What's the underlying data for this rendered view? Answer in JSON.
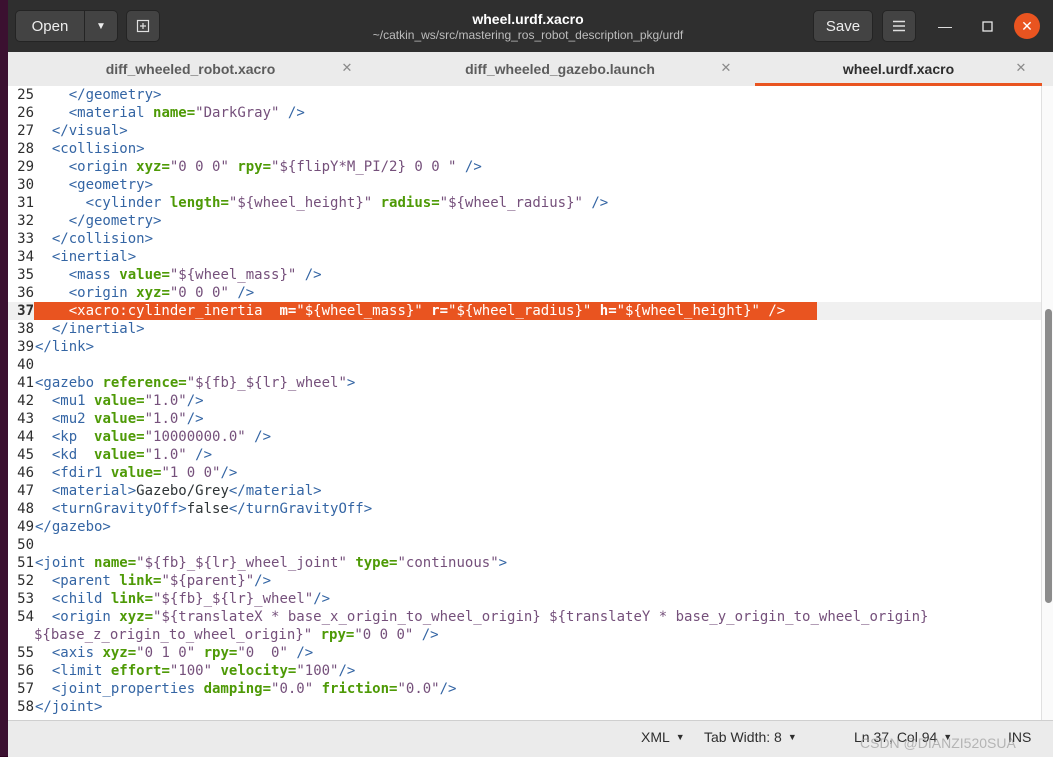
{
  "header": {
    "open_label": "Open",
    "title": "wheel.urdf.xacro",
    "path": "~/catkin_ws/src/mastering_ros_robot_description_pkg/urdf",
    "save_label": "Save"
  },
  "tabs": [
    {
      "label": "diff_wheeled_robot.xacro"
    },
    {
      "label": "diff_wheeled_gazebo.launch"
    },
    {
      "label": "wheel.urdf.xacro",
      "active": true
    }
  ],
  "colors": {
    "accent": "#e95420",
    "tag": "#3465a4",
    "attribute": "#4e9a06",
    "string": "#75507b"
  },
  "editor": {
    "lines": [
      {
        "n": "25",
        "tokens": [
          [
            "tx",
            "    "
          ],
          [
            "t",
            "</geometry>"
          ]
        ]
      },
      {
        "n": "26",
        "tokens": [
          [
            "tx",
            "    "
          ],
          [
            "t",
            "<material "
          ],
          [
            "a",
            "name="
          ],
          [
            "v",
            "\"DarkGray\""
          ],
          [
            "t",
            " />"
          ]
        ]
      },
      {
        "n": "27",
        "tokens": [
          [
            "tx",
            "  "
          ],
          [
            "t",
            "</visual>"
          ]
        ]
      },
      {
        "n": "28",
        "tokens": [
          [
            "tx",
            "  "
          ],
          [
            "t",
            "<collision>"
          ]
        ]
      },
      {
        "n": "29",
        "tokens": [
          [
            "tx",
            "    "
          ],
          [
            "t",
            "<origin "
          ],
          [
            "a",
            "xyz="
          ],
          [
            "v",
            "\"0 0 0\""
          ],
          [
            "tx",
            " "
          ],
          [
            "a",
            "rpy="
          ],
          [
            "v",
            "\"${flipY*M_PI/2} 0 0 \""
          ],
          [
            "t",
            " />"
          ]
        ]
      },
      {
        "n": "30",
        "tokens": [
          [
            "tx",
            "    "
          ],
          [
            "t",
            "<geometry>"
          ]
        ]
      },
      {
        "n": "31",
        "tokens": [
          [
            "tx",
            "      "
          ],
          [
            "t",
            "<cylinder "
          ],
          [
            "a",
            "length="
          ],
          [
            "v",
            "\"${wheel_height}\""
          ],
          [
            "tx",
            " "
          ],
          [
            "a",
            "radius="
          ],
          [
            "v",
            "\"${wheel_radius}\""
          ],
          [
            "t",
            " />"
          ]
        ]
      },
      {
        "n": "32",
        "tokens": [
          [
            "tx",
            "    "
          ],
          [
            "t",
            "</geometry>"
          ]
        ]
      },
      {
        "n": "33",
        "tokens": [
          [
            "tx",
            "  "
          ],
          [
            "t",
            "</collision>"
          ]
        ]
      },
      {
        "n": "34",
        "tokens": [
          [
            "tx",
            "  "
          ],
          [
            "t",
            "<inertial>"
          ]
        ]
      },
      {
        "n": "35",
        "tokens": [
          [
            "tx",
            "    "
          ],
          [
            "t",
            "<mass "
          ],
          [
            "a",
            "value="
          ],
          [
            "v",
            "\"${wheel_mass}\""
          ],
          [
            "t",
            " />"
          ]
        ]
      },
      {
        "n": "36",
        "tokens": [
          [
            "tx",
            "    "
          ],
          [
            "t",
            "<origin "
          ],
          [
            "a",
            "xyz="
          ],
          [
            "v",
            "\"0 0 0\""
          ],
          [
            "t",
            " />"
          ]
        ]
      },
      {
        "n": "37",
        "current": true,
        "tokens": [
          [
            "tx",
            "    "
          ],
          [
            "t",
            "<xacro:cylinder_inertia  "
          ],
          [
            "a",
            "m="
          ],
          [
            "v",
            "\"${wheel_mass}\""
          ],
          [
            "tx",
            " "
          ],
          [
            "a",
            "r="
          ],
          [
            "v",
            "\"${wheel_radius}\""
          ],
          [
            "tx",
            " "
          ],
          [
            "a",
            "h="
          ],
          [
            "v",
            "\"${wheel_height}\""
          ],
          [
            "t",
            " />"
          ]
        ]
      },
      {
        "n": "38",
        "tokens": [
          [
            "tx",
            "  "
          ],
          [
            "t",
            "</inertial>"
          ]
        ]
      },
      {
        "n": "39",
        "tokens": [
          [
            "t",
            "</link>"
          ]
        ]
      },
      {
        "n": "40",
        "tokens": []
      },
      {
        "n": "41",
        "tokens": [
          [
            "t",
            "<gazebo "
          ],
          [
            "a",
            "reference="
          ],
          [
            "v",
            "\"${fb}_${lr}_wheel\""
          ],
          [
            "t",
            ">"
          ]
        ]
      },
      {
        "n": "42",
        "tokens": [
          [
            "tx",
            "  "
          ],
          [
            "t",
            "<mu1 "
          ],
          [
            "a",
            "value="
          ],
          [
            "v",
            "\"1.0\""
          ],
          [
            "t",
            "/>"
          ]
        ]
      },
      {
        "n": "43",
        "tokens": [
          [
            "tx",
            "  "
          ],
          [
            "t",
            "<mu2 "
          ],
          [
            "a",
            "value="
          ],
          [
            "v",
            "\"1.0\""
          ],
          [
            "t",
            "/>"
          ]
        ]
      },
      {
        "n": "44",
        "tokens": [
          [
            "tx",
            "  "
          ],
          [
            "t",
            "<kp  "
          ],
          [
            "a",
            "value="
          ],
          [
            "v",
            "\"10000000.0\""
          ],
          [
            "t",
            " />"
          ]
        ]
      },
      {
        "n": "45",
        "tokens": [
          [
            "tx",
            "  "
          ],
          [
            "t",
            "<kd  "
          ],
          [
            "a",
            "value="
          ],
          [
            "v",
            "\"1.0\""
          ],
          [
            "t",
            " />"
          ]
        ]
      },
      {
        "n": "46",
        "tokens": [
          [
            "tx",
            "  "
          ],
          [
            "t",
            "<fdir1 "
          ],
          [
            "a",
            "value="
          ],
          [
            "v",
            "\"1 0 0\""
          ],
          [
            "t",
            "/>"
          ]
        ]
      },
      {
        "n": "47",
        "tokens": [
          [
            "tx",
            "  "
          ],
          [
            "t",
            "<material>"
          ],
          [
            "tx",
            "Gazebo/Grey"
          ],
          [
            "t",
            "</material>"
          ]
        ]
      },
      {
        "n": "48",
        "tokens": [
          [
            "tx",
            "  "
          ],
          [
            "t",
            "<turnGravityOff>"
          ],
          [
            "tx",
            "false"
          ],
          [
            "t",
            "</turnGravityOff>"
          ]
        ]
      },
      {
        "n": "49",
        "tokens": [
          [
            "t",
            "</gazebo>"
          ]
        ]
      },
      {
        "n": "50",
        "tokens": []
      },
      {
        "n": "51",
        "tokens": [
          [
            "t",
            "<joint "
          ],
          [
            "a",
            "name="
          ],
          [
            "v",
            "\"${fb}_${lr}_wheel_joint\""
          ],
          [
            "tx",
            " "
          ],
          [
            "a",
            "type="
          ],
          [
            "v",
            "\"continuous\""
          ],
          [
            "t",
            ">"
          ]
        ]
      },
      {
        "n": "52",
        "tokens": [
          [
            "tx",
            "  "
          ],
          [
            "t",
            "<parent "
          ],
          [
            "a",
            "link="
          ],
          [
            "v",
            "\"${parent}\""
          ],
          [
            "t",
            "/>"
          ]
        ]
      },
      {
        "n": "53",
        "tokens": [
          [
            "tx",
            "  "
          ],
          [
            "t",
            "<child "
          ],
          [
            "a",
            "link="
          ],
          [
            "v",
            "\"${fb}_${lr}_wheel\""
          ],
          [
            "t",
            "/>"
          ]
        ]
      },
      {
        "n": "54",
        "tokens": [
          [
            "tx",
            "  "
          ],
          [
            "t",
            "<origin "
          ],
          [
            "a",
            "xyz="
          ],
          [
            "v",
            "\"${translateX * base_x_origin_to_wheel_origin} ${translateY * base_y_origin_to_wheel_origin}"
          ]
        ]
      },
      {
        "n": "",
        "wrap": true,
        "tokens": [
          [
            "v",
            "${base_z_origin_to_wheel_origin}\""
          ],
          [
            "tx",
            " "
          ],
          [
            "a",
            "rpy="
          ],
          [
            "v",
            "\"0 0 0\""
          ],
          [
            "t",
            " />"
          ]
        ]
      },
      {
        "n": "55",
        "tokens": [
          [
            "tx",
            "  "
          ],
          [
            "t",
            "<axis "
          ],
          [
            "a",
            "xyz="
          ],
          [
            "v",
            "\"0 1 0\""
          ],
          [
            "tx",
            " "
          ],
          [
            "a",
            "rpy="
          ],
          [
            "v",
            "\"0  0\""
          ],
          [
            "t",
            " />"
          ]
        ]
      },
      {
        "n": "56",
        "tokens": [
          [
            "tx",
            "  "
          ],
          [
            "t",
            "<limit "
          ],
          [
            "a",
            "effort="
          ],
          [
            "v",
            "\"100\""
          ],
          [
            "tx",
            " "
          ],
          [
            "a",
            "velocity="
          ],
          [
            "v",
            "\"100\""
          ],
          [
            "t",
            "/>"
          ]
        ]
      },
      {
        "n": "57",
        "tokens": [
          [
            "tx",
            "  "
          ],
          [
            "t",
            "<joint_properties "
          ],
          [
            "a",
            "damping="
          ],
          [
            "v",
            "\"0.0\""
          ],
          [
            "tx",
            " "
          ],
          [
            "a",
            "friction="
          ],
          [
            "v",
            "\"0.0\""
          ],
          [
            "t",
            "/>"
          ]
        ]
      },
      {
        "n": "58",
        "tokens": [
          [
            "t",
            "</joint>"
          ]
        ]
      }
    ]
  },
  "status": {
    "language": "XML",
    "tab_width": "Tab Width: 8",
    "position": "Ln 37, Col 94",
    "mode": "INS"
  },
  "watermark": "CSDN @DIANZI520SUA"
}
